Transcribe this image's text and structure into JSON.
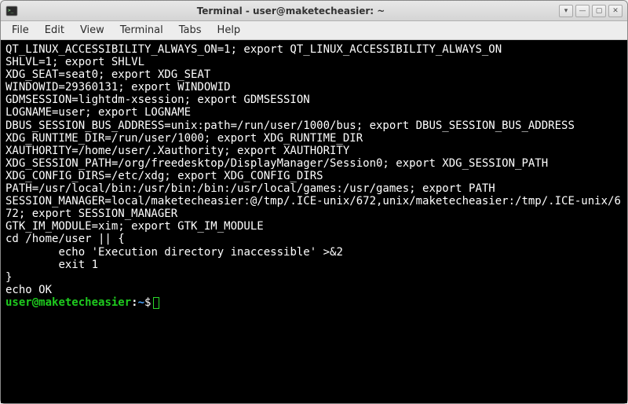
{
  "window": {
    "title": "Terminal - user@maketecheasier: ~"
  },
  "menu": {
    "file": "File",
    "edit": "Edit",
    "view": "View",
    "terminal": "Terminal",
    "tabs": "Tabs",
    "help": "Help"
  },
  "term": {
    "lines": [
      "QT_LINUX_ACCESSIBILITY_ALWAYS_ON=1; export QT_LINUX_ACCESSIBILITY_ALWAYS_ON",
      "SHLVL=1; export SHLVL",
      "XDG_SEAT=seat0; export XDG_SEAT",
      "WINDOWID=29360131; export WINDOWID",
      "GDMSESSION=lightdm-xsession; export GDMSESSION",
      "LOGNAME=user; export LOGNAME",
      "DBUS_SESSION_BUS_ADDRESS=unix:path=/run/user/1000/bus; export DBUS_SESSION_BUS_ADDRESS",
      "XDG_RUNTIME_DIR=/run/user/1000; export XDG_RUNTIME_DIR",
      "XAUTHORITY=/home/user/.Xauthority; export XAUTHORITY",
      "XDG_SESSION_PATH=/org/freedesktop/DisplayManager/Session0; export XDG_SESSION_PATH",
      "XDG_CONFIG_DIRS=/etc/xdg; export XDG_CONFIG_DIRS",
      "PATH=/usr/local/bin:/usr/bin:/bin:/usr/local/games:/usr/games; export PATH",
      "SESSION_MANAGER=local/maketecheasier:@/tmp/.ICE-unix/672,unix/maketecheasier:/tmp/.ICE-unix/672; export SESSION_MANAGER",
      "GTK_IM_MODULE=xim; export GTK_IM_MODULE",
      "cd /home/user || {",
      "        echo 'Execution directory inaccessible' >&2",
      "        exit 1",
      "}",
      "echo OK",
      ""
    ]
  },
  "prompt": {
    "user": "user",
    "at": "@",
    "host": "maketecheasier",
    "colon": ":",
    "path": "~",
    "dollar": "$"
  },
  "controls": {
    "show_on_all": "▾",
    "minimize": "—",
    "maximize": "▢",
    "close": "✕"
  }
}
